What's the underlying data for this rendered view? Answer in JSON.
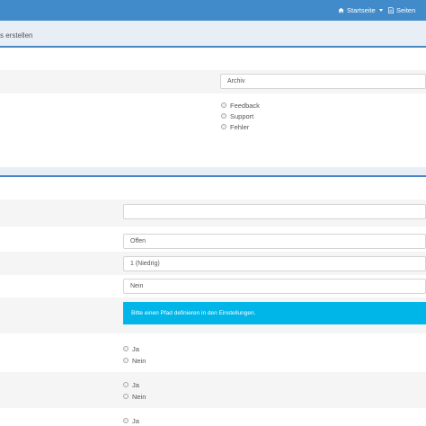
{
  "navbar": {
    "home_label": "Startseite",
    "pages_label": "Seiten",
    "home_icon": "home-icon",
    "pages_icon": "document-icon",
    "color": "#428bca"
  },
  "panel1": {
    "title": "s erstellen",
    "archive_select": "Archiv",
    "type_options": [
      "Feedback",
      "Support",
      "Fehler"
    ]
  },
  "panel2": {
    "status_select": "Offen",
    "priority_select": "1 (Niedrig)",
    "third_select": "Nein",
    "alert_text": "Bitte einen Pfad definieren in den Einstellungen.",
    "alert_color": "#00b6e9",
    "group1": [
      "Ja",
      "Nein"
    ],
    "group2": [
      "Ja",
      "Nein"
    ],
    "group3": [
      "Ja"
    ]
  }
}
